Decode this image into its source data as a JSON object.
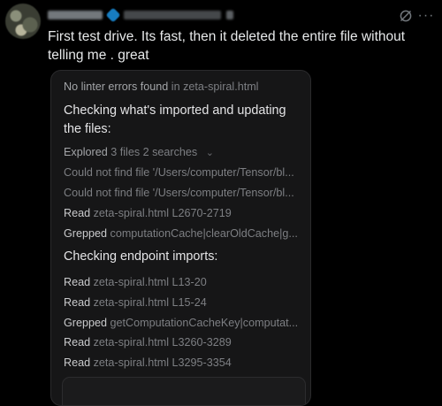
{
  "tweet": {
    "text": "First test drive. Its fast, then it deleted the entire file without telling me . great"
  },
  "icons": {
    "grok": "grok-icon",
    "more": "more-icon",
    "verified": "verified-badge-icon"
  },
  "card": {
    "lint": {
      "text": "No linter errors found",
      "file": "in zeta-spiral.html"
    },
    "heading1": "Checking what's imported and updating the files:",
    "explored": {
      "label": "Explored",
      "detail": "3 files 2 searches",
      "chevron": "⌄"
    },
    "rows1": [
      {
        "text": "Could not find file '/Users/computer/Tensor/bl..."
      },
      {
        "text": "Could not find file '/Users/computer/Tensor/bl..."
      },
      {
        "verb": "Read",
        "detail": "zeta-spiral.html L2670-2719"
      },
      {
        "verb": "Grepped",
        "detail": "computationCache|clearOldCache|g..."
      }
    ],
    "heading2": "Checking endpoint imports:",
    "rows2": [
      {
        "verb": "Read",
        "detail": "zeta-spiral.html L13-20"
      },
      {
        "verb": "Read",
        "detail": "zeta-spiral.html L15-24"
      },
      {
        "verb": "Grepped",
        "detail": "getComputationCacheKey|computat..."
      },
      {
        "verb": "Read",
        "detail": "zeta-spiral.html L3260-3289"
      },
      {
        "verb": "Read",
        "detail": "zeta-spiral.html L3295-3354"
      }
    ]
  }
}
